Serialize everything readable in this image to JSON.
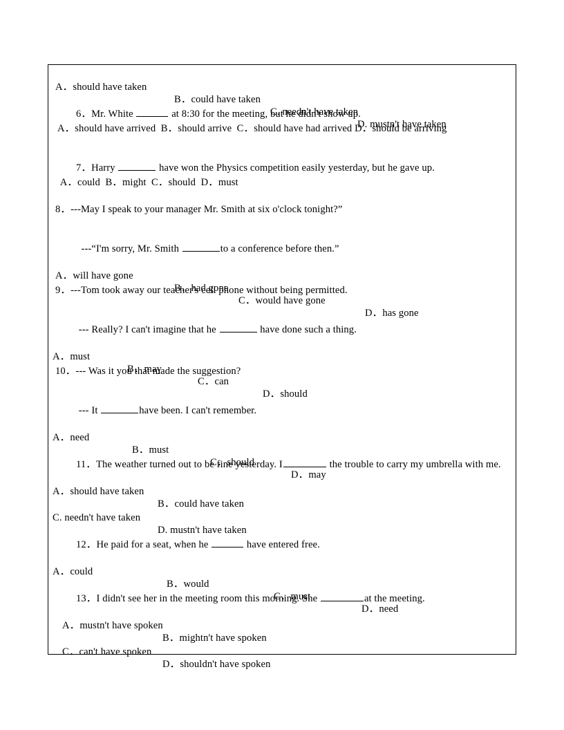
{
  "document": {
    "type": "english-grammar-worksheet",
    "topic": "modal verbs",
    "page_background": "#ffffff",
    "border_color": "#000000"
  },
  "lines": {
    "q5_options": {
      "a": "A．should have taken",
      "b": "B．could have taken",
      "c": "C. needn't have taken",
      "d": "D. mustn't have taken"
    },
    "q6_stem_pre": "6．Mr. White ",
    "q6_stem_post": " at 8:30 for the meeting, but he didn't show up.",
    "q6_options": " A．should have arrived  B．should arrive  C．should have had arrived D．should be arriving",
    "q7_stem_pre": "7．Harry ",
    "q7_stem_post": " have won the Physics competition easily yesterday, but he gave up.",
    "q7_options": "  A．could  B．might  C．should  D．must",
    "q8_stem": "8．---May I speak to your manager Mr. Smith at six o'clock tonight?”",
    "q8_stem2_pre": "  ---“I'm sorry, Mr. Smith ",
    "q8_stem2_post": "to a conference before then.”",
    "q8_options": {
      "a": "A．will have gone",
      "b": "B．had gone",
      "c": "C．would have gone",
      "d": "D．has gone"
    },
    "q9_stem": "9．---Tom took away our teacher's cell phone without being permitted.",
    "q9_stem2_pre": " --- Really? I can't imagine that he ",
    "q9_stem2_post": " have done such a thing.",
    "q9_options": {
      "a": "A．must",
      "b": "B．may",
      "c": "C．can",
      "d": "D．should"
    },
    "q10_stem": "10．--- Was it you that made the suggestion?",
    "q10_stem2_pre": " --- It ",
    "q10_stem2_post": "have been. I can't remember.",
    "q10_options": {
      "a": "A．need",
      "b": "B．must",
      "c": "C．should",
      "d": "D．may"
    },
    "q11_stem_pre": "11．The weather turned out to be fine yesterday. I",
    "q11_stem_post": " the trouble to carry my umbrella with me.",
    "q11_options": {
      "a": "A．should have taken",
      "b": "B．could have taken",
      "c": "C. needn't have taken",
      "d": "D. mustn't have taken"
    },
    "q12_stem_pre": "12．He paid for a seat, when he ",
    "q12_stem_post": " have entered free.",
    "q12_options": {
      "a": "A．could",
      "b": "B．would",
      "c": "C．must",
      "d": "D．need"
    },
    "q13_stem_pre": "13．I didn't see her in the meeting room this morning. She ",
    "q13_stem_post": "at the meeting.",
    "q13_options": {
      "a": "A．mustn't have spoken",
      "b": "B．mightn't have spoken",
      "c": "C．can't have spoken",
      "d": "D．shouldn't have spoken"
    }
  }
}
